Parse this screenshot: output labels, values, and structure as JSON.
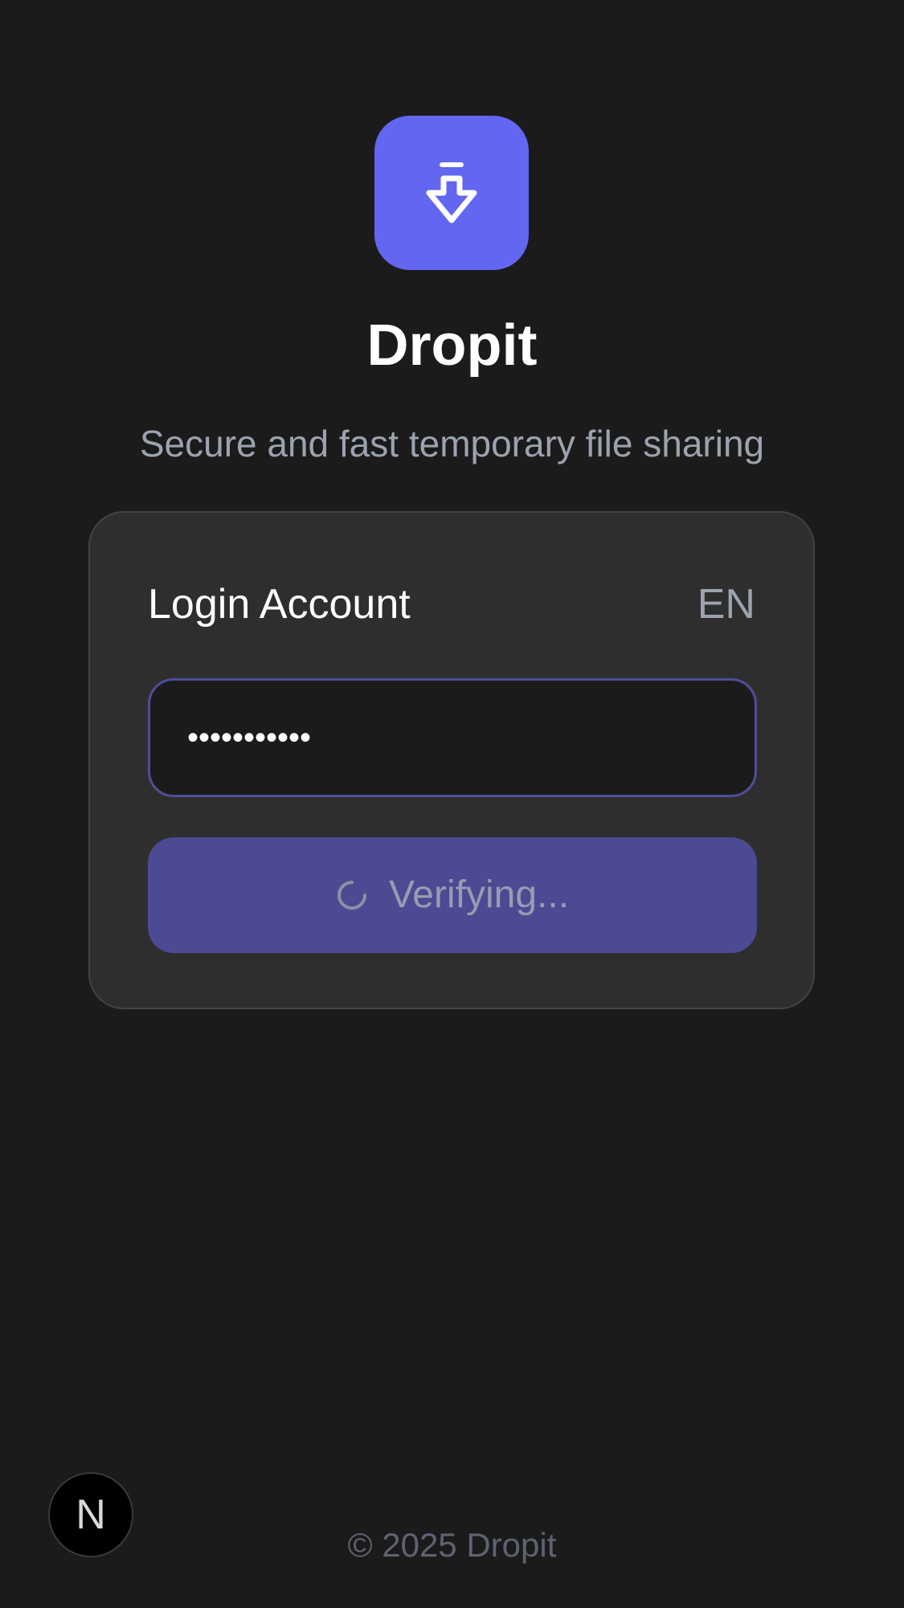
{
  "brand": {
    "name": "Dropit",
    "tagline": "Secure and fast temporary file sharing",
    "accent_color": "#6366f1",
    "logo_icon": "download-arrow-icon"
  },
  "login_card": {
    "title": "Login Account",
    "language": "EN",
    "password_value": "•••••••••••",
    "submit_label": "Verifying...",
    "submit_state": "loading"
  },
  "dev_badge": {
    "letter": "N"
  },
  "footer": {
    "copyright": "© 2025 Dropit"
  }
}
